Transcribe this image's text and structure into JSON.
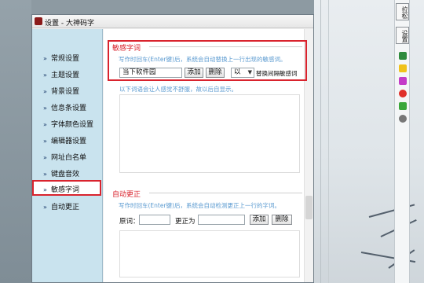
{
  "window": {
    "title": "设置 - 大神码字"
  },
  "sidebar": {
    "items": [
      {
        "label": "常规设置"
      },
      {
        "label": "主题设置"
      },
      {
        "label": "背景设置"
      },
      {
        "label": "信息条设置"
      },
      {
        "label": "字体颜色设置"
      },
      {
        "label": "编辑器设置"
      },
      {
        "label": "网址白名单"
      },
      {
        "label": "键盘音效"
      },
      {
        "label": "敏感字词"
      },
      {
        "label": "自动更正"
      }
    ],
    "selected_index": 8
  },
  "sensitive": {
    "title": "敏感字词",
    "hint": "写作时回车(Enter键)后，系统会自动替换上一行出现的敏感词。",
    "input_value": "当下软件园",
    "add_label": "添加",
    "delete_label": "删除",
    "select_value": "以",
    "replace_label": "替换间隔敏感词",
    "note": "以下词语会让人感觉不舒服，故以后自显示。"
  },
  "autocorrect": {
    "title": "自动更正",
    "hint": "写作时回车(Enter键)后，系统会自动检测更正上一行的字词。",
    "original_label": "原词：",
    "correct_label": "更正为",
    "add_label": "添加",
    "delete_label": "删除"
  },
  "side_strip": {
    "btn1": "拉松",
    "btn2": "设置"
  }
}
